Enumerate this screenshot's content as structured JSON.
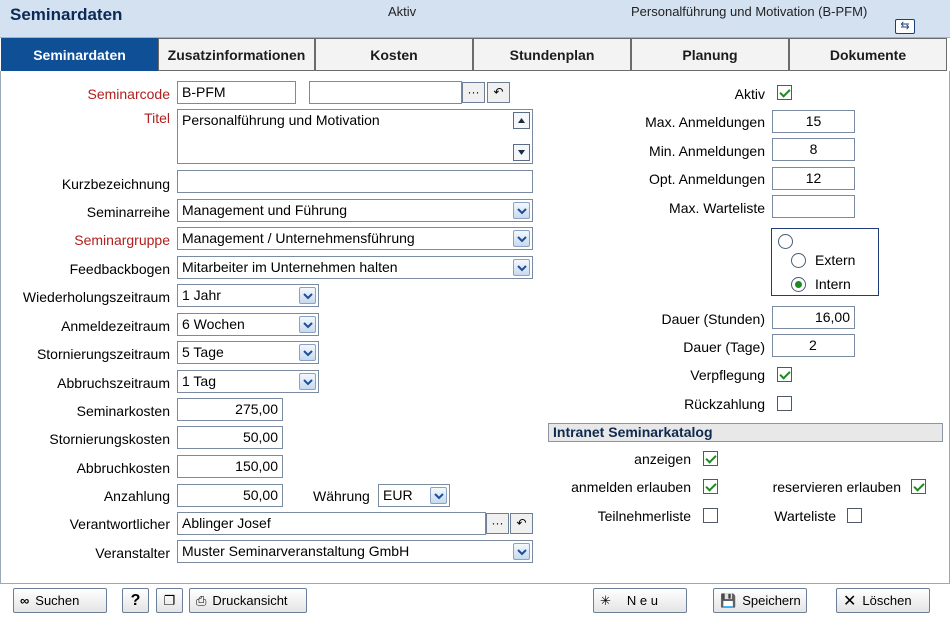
{
  "header": {
    "title": "Seminardaten",
    "status": "Aktiv",
    "seminar_name": "Personalführung und Motivation (B-PFM)"
  },
  "tabs": [
    {
      "label": "Seminardaten",
      "active": true
    },
    {
      "label": "Zusatzinformationen"
    },
    {
      "label": "Kosten"
    },
    {
      "label": "Stundenplan"
    },
    {
      "label": "Planung"
    },
    {
      "label": "Dokumente"
    }
  ],
  "left": {
    "seminarcode": {
      "label": "Seminarcode",
      "value": "B-PFM",
      "value2": ""
    },
    "titel": {
      "label": "Titel",
      "value": "Personalführung und Motivation"
    },
    "kurzbezeichnung": {
      "label": "Kurzbezeichnung",
      "value": ""
    },
    "seminarreihe": {
      "label": "Seminarreihe",
      "value": "Management und Führung"
    },
    "seminargruppe": {
      "label": "Seminargruppe",
      "value": "Management / Unternehmensführung"
    },
    "feedbackbogen": {
      "label": "Feedbackbogen",
      "value": "Mitarbeiter im Unternehmen halten"
    },
    "wiederholungszeitraum": {
      "label": "Wiederholungszeitraum",
      "value": "1 Jahr"
    },
    "anmeldezeitraum": {
      "label": "Anmeldezeitraum",
      "value": "6 Wochen"
    },
    "stornierungszeitraum": {
      "label": "Stornierungszeitraum",
      "value": "5 Tage"
    },
    "abbruchszeitraum": {
      "label": "Abbruchszeitraum",
      "value": "1 Tag"
    },
    "seminarkosten": {
      "label": "Seminarkosten",
      "value": "275,00"
    },
    "stornierungskosten": {
      "label": "Stornierungskosten",
      "value": "50,00"
    },
    "abbruchkosten": {
      "label": "Abbruchkosten",
      "value": "150,00"
    },
    "anzahlung": {
      "label": "Anzahlung",
      "value": "50,00"
    },
    "waehrung": {
      "label": "Währung",
      "value": "EUR"
    },
    "verantwortlicher": {
      "label": "Verantwortlicher",
      "value": "Ablinger Josef"
    },
    "veranstalter": {
      "label": "Veranstalter",
      "value": "Muster Seminarveranstaltung GmbH"
    }
  },
  "right": {
    "aktiv": {
      "label": "Aktiv",
      "checked": true
    },
    "max_anmeldungen": {
      "label": "Max. Anmeldungen",
      "value": "15"
    },
    "min_anmeldungen": {
      "label": "Min. Anmeldungen",
      "value": "8"
    },
    "opt_anmeldungen": {
      "label": "Opt. Anmeldungen",
      "value": "12"
    },
    "max_warteliste": {
      "label": "Max. Warteliste",
      "value": ""
    },
    "radio_extern": "Extern",
    "radio_intern": "Intern",
    "dauer_stunden": {
      "label": "Dauer (Stunden)",
      "value": "16,00"
    },
    "dauer_tage": {
      "label": "Dauer (Tage)",
      "value": "2"
    },
    "verpflegung": {
      "label": "Verpflegung",
      "checked": true
    },
    "rueckzahlung": {
      "label": "Rückzahlung",
      "checked": false
    }
  },
  "intranet": {
    "title": "Intranet Seminarkatalog",
    "anzeigen": {
      "label": "anzeigen",
      "checked": true
    },
    "anmelden": {
      "label": "anmelden erlauben",
      "checked": true
    },
    "reservieren": {
      "label": "reservieren erlauben",
      "checked": true
    },
    "teilnehmerliste": {
      "label": "Teilnehmerliste",
      "checked": false
    },
    "warteliste": {
      "label": "Warteliste",
      "checked": false
    }
  },
  "footer": {
    "suchen": "Suchen",
    "help": "?",
    "druckansicht": "Druckansicht",
    "neu": "N e u",
    "speichern": "Speichern",
    "loeschen": "Löschen"
  }
}
